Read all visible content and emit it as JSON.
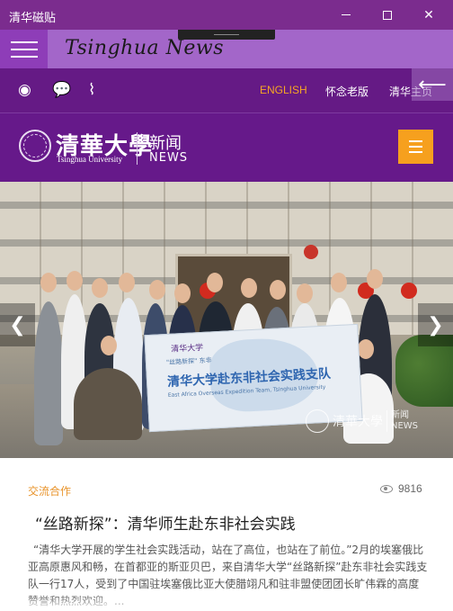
{
  "window": {
    "title": "清华磁贴",
    "controls": {
      "minimize": "minimize-icon",
      "maximize": "maximize-icon",
      "close": "close-icon"
    }
  },
  "appbar": {
    "title": "Tsinghua News"
  },
  "topnav": {
    "social_icons": [
      "weibo-icon",
      "wechat-icon",
      "rss-icon"
    ],
    "links": [
      "ENGLISH",
      "怀念老版",
      "清华主页"
    ]
  },
  "brand": {
    "name_cn": "清華大學",
    "name_en": "Tsinghua University",
    "section_cn": "新闻",
    "section_en": "NEWS"
  },
  "photo": {
    "banner_logo": "清华大学",
    "banner_sub": "\"丝路新探\" 东非",
    "banner_title": "清华大学赴东非社会实践支队",
    "banner_en": "East Africa Overseas Expedition Team, Tsinghua University",
    "watermark_cn": "清華大學",
    "watermark_news_cn": "新闻",
    "watermark_news_en": "NEWS"
  },
  "article": {
    "category": "交流合作",
    "views": "9816",
    "headline": "“丝路新探”：清华师生赴东非社会实践",
    "summary": "“清华大学开展的学生社会实践活动，站在了高位，也站在了前位。”2月的埃塞俄比亚高原惠风和畅，在首都亚的斯亚贝巴，来自清华大学“丝路新探”赴东非社会实践支队一行17人，受到了中国驻埃塞俄比亚大使腊翊凡和驻非盟使团团长旷伟霖的高度赞誉和热烈欢迎。..."
  },
  "colors": {
    "titlebar": "#7b2c8e",
    "nav": "#651a85",
    "accent": "#f6a01e"
  }
}
